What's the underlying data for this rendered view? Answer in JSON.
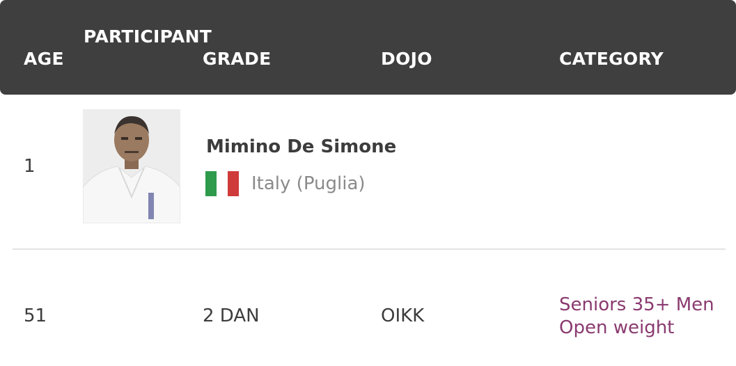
{
  "header": {
    "age": "AGE",
    "participant": "PARTICIPANT",
    "grade": "GRADE",
    "dojo": "DOJO",
    "category": "CATEGORY"
  },
  "participant": {
    "number": "1",
    "name": "Mimino De Simone",
    "country": "Italy (Puglia)",
    "flag_colors": [
      "#2e9a4c",
      "#ffffff",
      "#cf3a3a"
    ],
    "photo_icon": "person-photo"
  },
  "details": {
    "age": "51",
    "grade": "2 DAN",
    "dojo": "OIKK",
    "category_line1": "Seniors 35+ Men",
    "category_line2": "Open weight"
  },
  "colors": {
    "header_bg": "#3f3f3f",
    "category_link": "#8a3a6f"
  }
}
